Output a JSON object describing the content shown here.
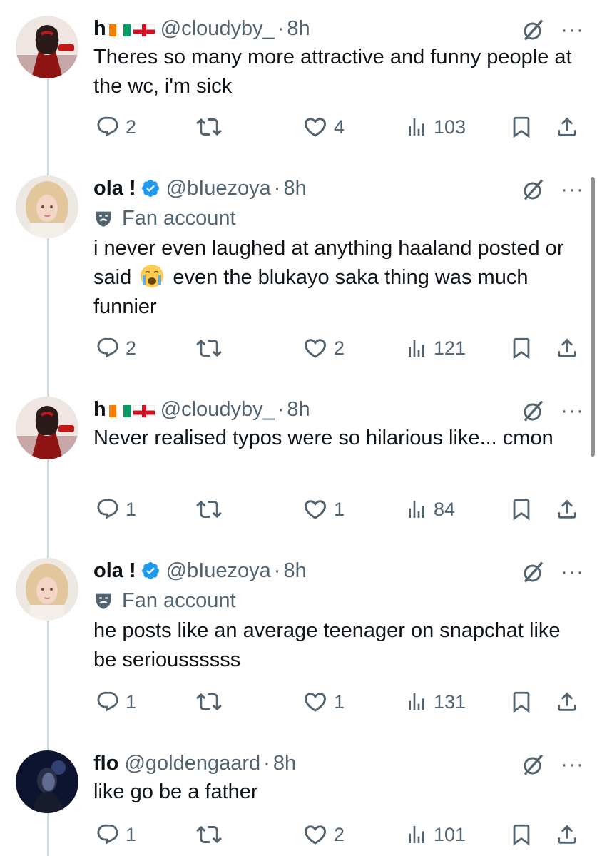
{
  "tweets": [
    {
      "name": "h",
      "flags": [
        "ci",
        "eng"
      ],
      "verified": false,
      "handle": "@cloudyby_",
      "sep": "·",
      "time": "8h",
      "badge": "",
      "text": "Theres so many more attractive and funny people at the wc, i'm sick",
      "replies": "2",
      "reposts": "",
      "likes": "4",
      "views": "103",
      "avatar": "girl-red"
    },
    {
      "name": "ola !",
      "flags": [],
      "verified": true,
      "handle": "@bIuezoya",
      "sep": "·",
      "time": "8h",
      "badge": "Fan account",
      "text_a": "i never even laughed at anything haaland posted or said",
      "text_b": "even the blukayo saka thing was much funnier",
      "replies": "2",
      "reposts": "",
      "likes": "2",
      "views": "121",
      "avatar": "blonde"
    },
    {
      "name": "h",
      "flags": [
        "ci",
        "eng"
      ],
      "verified": false,
      "handle": "@cloudyby_",
      "sep": "·",
      "time": "8h",
      "badge": "",
      "text": "Never realised typos were so hilarious like... cmon",
      "replies": "1",
      "reposts": "",
      "likes": "1",
      "views": "84",
      "avatar": "girl-red"
    },
    {
      "name": "ola !",
      "flags": [],
      "verified": true,
      "handle": "@bIuezoya",
      "sep": "·",
      "time": "8h",
      "badge": "Fan account",
      "text": "he posts like an average teenager on snapchat like be serioussssss",
      "replies": "1",
      "reposts": "",
      "likes": "1",
      "views": "131",
      "avatar": "blonde"
    },
    {
      "name": "flo",
      "flags": [],
      "verified": false,
      "handle": "@goldengaard",
      "sep": "·",
      "time": "8h",
      "badge": "",
      "text": "like go be a father",
      "replies": "1",
      "reposts": "",
      "likes": "2",
      "views": "101",
      "avatar": "dark-blue"
    }
  ],
  "colors": {
    "text": "#0f1419",
    "muted": "#536471",
    "verified": "#1d9bf0",
    "line": "#cfd9de"
  },
  "icons": [
    "reply-icon",
    "repost-icon",
    "like-icon",
    "views-icon",
    "bookmark-icon",
    "share-icon",
    "grok-icon",
    "more-icon",
    "fan-account-icon",
    "verified-badge-icon",
    "loudly-crying-face-emoji"
  ]
}
